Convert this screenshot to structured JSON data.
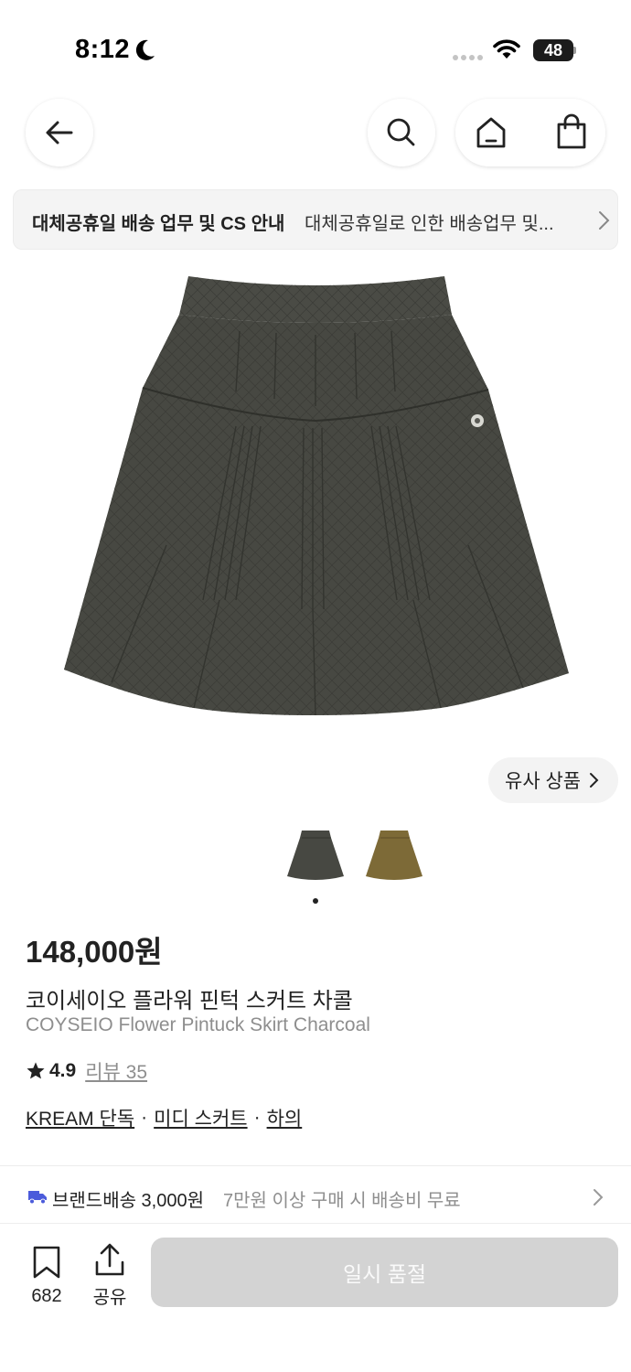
{
  "status": {
    "time": "8:12",
    "battery": "48"
  },
  "notice": {
    "title": "대체공휴일 배송 업무 및 CS 안내",
    "description": "대체공휴일로 인한 배송업무 및..."
  },
  "similar": {
    "label": "유사 상품"
  },
  "product": {
    "price": "148,000원",
    "name_ko": "코이세이오 플라워 핀턱 스커트 차콜",
    "name_en": "COYSEIO Flower Pintuck Skirt Charcoal",
    "rating": "4.9",
    "review_label": "리뷰 35",
    "tags": [
      "KREAM 단독",
      "미디 스커트",
      "하의"
    ],
    "tag_separator": "·",
    "thumbnails_selected_index": 0,
    "colors": {
      "charcoal": "#474842",
      "khaki": "#7d6a37"
    }
  },
  "shipping": {
    "main": "브랜드배송 3,000원",
    "sub": "7만원 이상 구매 시 배송비 무료",
    "truck_color": "#4b5bdb"
  },
  "bottom": {
    "bookmark_count": "682",
    "share_label": "공유",
    "buy_label": "일시 품절"
  },
  "icons": {
    "back": "arrow-left-icon",
    "search": "search-icon",
    "home": "home-icon",
    "bag": "shopping-bag-icon",
    "bookmark": "bookmark-icon",
    "share": "share-icon",
    "truck": "truck-icon"
  }
}
